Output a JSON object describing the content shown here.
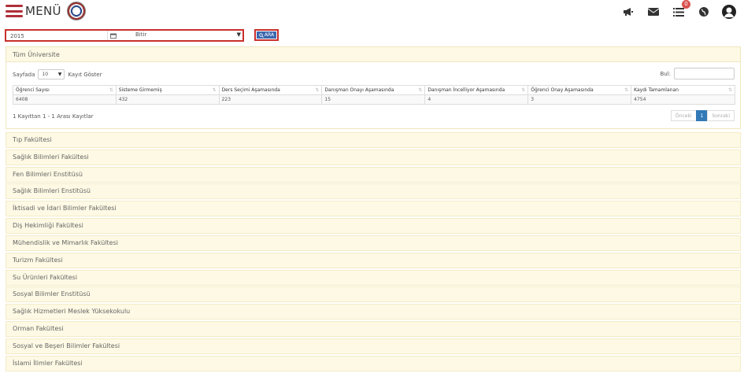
{
  "header": {
    "menu_label": "MENÜ",
    "notification_count": "0",
    "icons": [
      "megaphone-icon",
      "mail-icon",
      "list-icon",
      "globe-icon",
      "user-icon"
    ]
  },
  "filter": {
    "year_value": "2015",
    "select_value": "Bitir",
    "search_label": "ARA"
  },
  "panel": {
    "title": "Tüm Üniversite",
    "length_prefix": "Sayfada",
    "length_value": "10",
    "length_suffix": "Kayıt Göster",
    "find_label": "Bul:",
    "columns": [
      "Öğrenci Sayısı",
      "Sisteme Girmemiş",
      "Ders Seçimi Aşamasında",
      "Danışman Onayı Aşamasında",
      "Danışman İncelliyor Aşamasında",
      "Öğrenci Onay Aşamasında",
      "Kaydı Tamamlanan"
    ],
    "rows": [
      [
        "6408",
        "432",
        "223",
        "15",
        "4",
        "3",
        "4754"
      ]
    ],
    "info": "1 Kayıttan 1 - 1 Arası Kayıtlar",
    "pager": {
      "prev": "Önceki",
      "page": "1",
      "next": "Sonraki"
    }
  },
  "faculties": [
    "Tıp Fakültesi",
    "Sağlık Bilimleri Fakültesi",
    "Fen Bilimleri Enstitüsü",
    "Sağlık Bilimleri Enstitüsü",
    "İktisadi ve İdari Bilimler Fakültesi",
    "Diş Hekimliği Fakültesi",
    "Mühendislik ve Mimarlık Fakültesi",
    "Turizm Fakültesi",
    "Su Ürünleri Fakültesi",
    "Sosyal Bilimler Enstitüsü",
    "Sağlık Hizmetleri Meslek Yüksekokulu",
    "Orman Fakültesi",
    "Sosyal ve Beşeri Bilimler Fakültesi",
    "İslami İlimler Fakültesi"
  ],
  "colors": {
    "accent_red": "#c9302c",
    "primary_blue": "#3b67ad",
    "panel_bg": "#fdf9e4"
  }
}
